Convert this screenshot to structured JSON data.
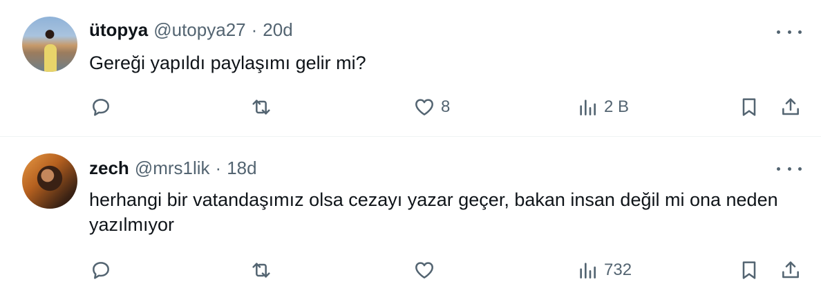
{
  "tweets": [
    {
      "name": "ütopya",
      "handle": "@utopya27",
      "separator": "·",
      "time": "20d",
      "text": "Gereği yapıldı paylaşımı gelir mi?",
      "reply_count": "",
      "retweet_count": "",
      "like_count": "8",
      "view_count": "2 B"
    },
    {
      "name": "zech",
      "handle": "@mrs1lik",
      "separator": "·",
      "time": "18d",
      "text": "herhangi bir vatandaşımız olsa cezayı yazar geçer, bakan insan değil mi ona neden yazılmıyor",
      "reply_count": "",
      "retweet_count": "",
      "like_count": "",
      "view_count": "732"
    }
  ],
  "icons": {
    "more": "more-horizontal-icon",
    "reply": "reply-icon",
    "retweet": "retweet-icon",
    "like": "heart-icon",
    "views": "views-icon",
    "bookmark": "bookmark-icon",
    "share": "share-icon"
  },
  "colors": {
    "text_primary": "#0f1419",
    "text_secondary": "#536471",
    "divider": "#eff3f4"
  }
}
